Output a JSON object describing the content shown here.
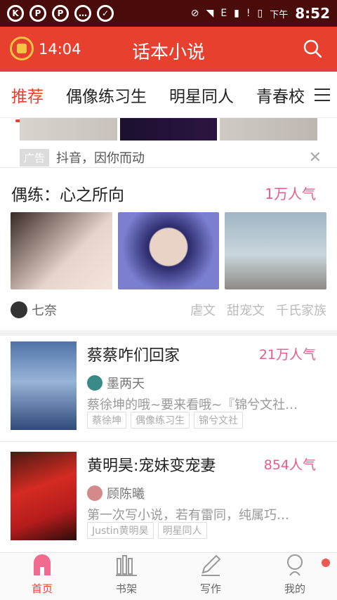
{
  "status_bar": {
    "time": "8:52",
    "time_prefix": "下午",
    "network": "E",
    "icons": [
      "k-icon",
      "p-icon",
      "p-icon",
      "chat-icon",
      "shield-icon",
      "mute-icon",
      "wifi-icon",
      "signal-icon",
      "alert-icon",
      "battery-icon"
    ]
  },
  "header": {
    "time": "14:04",
    "title": "话本小说",
    "accent": "#e8402f"
  },
  "tabs": [
    {
      "label": "推荐",
      "active": true
    },
    {
      "label": "偶像练习生",
      "active": false
    },
    {
      "label": "明星同人",
      "active": false
    },
    {
      "label": "青春校",
      "active": false
    }
  ],
  "ad": {
    "badge": "广告",
    "text": "抖音，因你而动"
  },
  "featured": {
    "title": "偶练：心之所向",
    "popularity": "1万人气",
    "author": "七奈",
    "tags": [
      "虐文",
      "甜宠文",
      "千氏家族"
    ]
  },
  "books": [
    {
      "title": "蔡蔡咋们回家",
      "popularity": "21万人气",
      "author": "墨两天",
      "desc": "蔡徐坤的哦~要来看哦~『锦兮文社…",
      "tags": [
        "蔡徐坤",
        "偶像练习生",
        "锦兮文社"
      ]
    },
    {
      "title": "黄明昊:宠妹变宠妻",
      "popularity": "854人气",
      "author": "顾陈曦",
      "desc": "第一次写小说，若有雷同，纯属巧…",
      "tags": [
        "Justin黄明昊",
        "明星同人"
      ]
    }
  ],
  "bottom_nav": [
    {
      "label": "首页",
      "icon": "home-icon",
      "active": true
    },
    {
      "label": "书架",
      "icon": "bookshelf-icon",
      "active": false
    },
    {
      "label": "写作",
      "icon": "pen-icon",
      "active": false
    },
    {
      "label": "我的",
      "icon": "profile-icon",
      "active": false
    }
  ]
}
